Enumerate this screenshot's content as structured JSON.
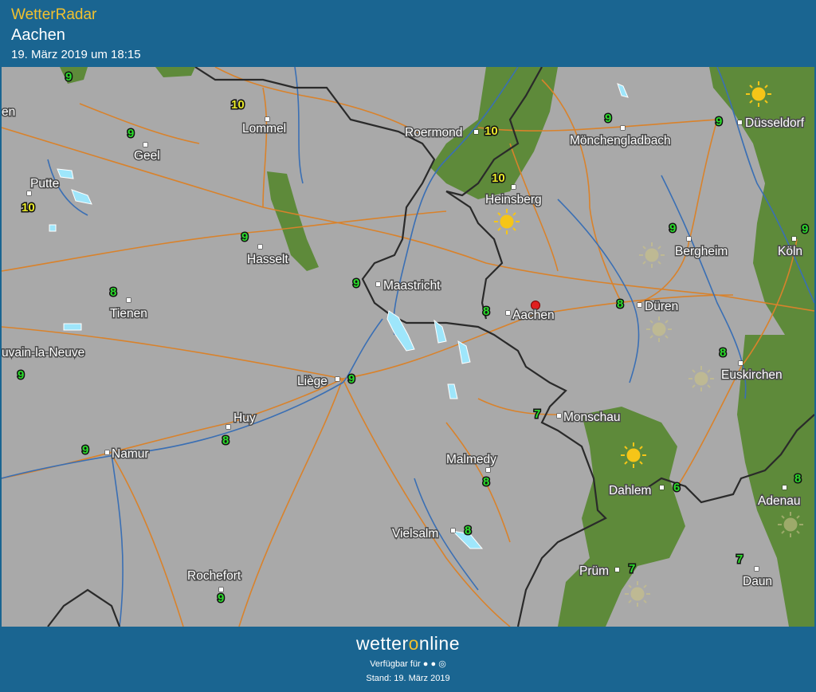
{
  "header": {
    "app_title": "WetterRadar",
    "location": "Aachen",
    "timestamp": "19. März 2019 um 18:15"
  },
  "map": {
    "colors": {
      "land": "#a9a9a9",
      "forest": "#5e8a3a",
      "border": "#2a2a2a",
      "road": "#d9822b",
      "river": "#3a6fb4",
      "temp_green": "#2bdc2b",
      "temp_yellow": "#e8e82a",
      "precip": "#9ee6fb",
      "pin": "#e02020"
    },
    "cities": [
      {
        "id": "lommel",
        "label": "Lommel"
      },
      {
        "id": "roermond",
        "label": "Roermond"
      },
      {
        "id": "monchengladbach",
        "label": "Mönchengladbach"
      },
      {
        "id": "dusseldorf",
        "label": "Düsseldorf"
      },
      {
        "id": "geel",
        "label": "Geel"
      },
      {
        "id": "putte",
        "label": "Putte"
      },
      {
        "id": "heinsberg",
        "label": "Heinsberg"
      },
      {
        "id": "bergheim",
        "label": "Bergheim"
      },
      {
        "id": "koln",
        "label": "Köln"
      },
      {
        "id": "hasselt",
        "label": "Hasselt"
      },
      {
        "id": "maastricht",
        "label": "Maastricht"
      },
      {
        "id": "tienen",
        "label": "Tienen"
      },
      {
        "id": "aachen",
        "label": "Aachen"
      },
      {
        "id": "duren",
        "label": "Düren"
      },
      {
        "id": "louvain",
        "label": "uvain-la-Neuve"
      },
      {
        "id": "liege",
        "label": "Liège"
      },
      {
        "id": "euskirchen",
        "label": "Euskirchen"
      },
      {
        "id": "huy",
        "label": "Huy"
      },
      {
        "id": "monschau",
        "label": "Monschau"
      },
      {
        "id": "namur",
        "label": "Namur"
      },
      {
        "id": "malmedy",
        "label": "Malmedy"
      },
      {
        "id": "dahlem",
        "label": "Dahlem"
      },
      {
        "id": "adenau",
        "label": "Adenau"
      },
      {
        "id": "vielsalm",
        "label": "Vielsalm"
      },
      {
        "id": "prum",
        "label": "Prüm"
      },
      {
        "id": "daun",
        "label": "Daun"
      },
      {
        "id": "rochefort",
        "label": "Rochefort"
      },
      {
        "id": "en",
        "label": "en"
      }
    ],
    "temperatures": [
      {
        "id": "t1",
        "value": "9"
      },
      {
        "id": "t2",
        "value": "10"
      },
      {
        "id": "t3",
        "value": "10"
      },
      {
        "id": "t4",
        "value": "9"
      },
      {
        "id": "t5",
        "value": "9"
      },
      {
        "id": "t6",
        "value": "9"
      },
      {
        "id": "t7",
        "value": "10"
      },
      {
        "id": "t8",
        "value": "10"
      },
      {
        "id": "t9",
        "value": "9"
      },
      {
        "id": "t10",
        "value": "9"
      },
      {
        "id": "t11",
        "value": "9"
      },
      {
        "id": "t12",
        "value": "8"
      },
      {
        "id": "t13",
        "value": "9"
      },
      {
        "id": "t14",
        "value": "8"
      },
      {
        "id": "t15",
        "value": "8"
      },
      {
        "id": "t16",
        "value": "9"
      },
      {
        "id": "t17",
        "value": "9"
      },
      {
        "id": "t18",
        "value": "8"
      },
      {
        "id": "t19",
        "value": "8"
      },
      {
        "id": "t20",
        "value": "7"
      },
      {
        "id": "t21",
        "value": "9"
      },
      {
        "id": "t22",
        "value": "8"
      },
      {
        "id": "t23",
        "value": "6"
      },
      {
        "id": "t24",
        "value": "8"
      },
      {
        "id": "t25",
        "value": "8"
      },
      {
        "id": "t26",
        "value": "7"
      },
      {
        "id": "t27",
        "value": "7"
      },
      {
        "id": "t28",
        "value": "9"
      }
    ]
  },
  "footer": {
    "brand_a": "wetter",
    "brand_o": "o",
    "brand_b": "nline",
    "available_label": "Verfügbar für",
    "platform_icons": "android-icon apple-icon web-icon",
    "stand": "Stand: 19. März 2019"
  }
}
